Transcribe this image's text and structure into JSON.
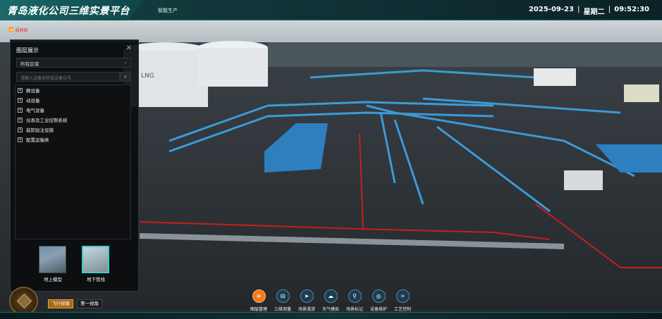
{
  "header": {
    "title": "青岛液化公司三维实景平台",
    "nav_tab": "智能生产",
    "date": "2025-09-23",
    "separator": "|",
    "weekday": "星期二",
    "time": "09:52:30"
  },
  "status": {
    "wifi_text": "弱网络"
  },
  "panel": {
    "title": "图层展示",
    "close": "✕",
    "region_select": "所有区域",
    "search_placeholder": "请输入设备名称或设备位号",
    "tree_items": [
      {
        "label": "静设备"
      },
      {
        "label": "动设备"
      },
      {
        "label": "电气设备"
      },
      {
        "label": "仪表及工业控制系统"
      },
      {
        "label": "装卸加注设施"
      },
      {
        "label": "配置运输类"
      }
    ],
    "thumbnails": [
      {
        "label": "地上模型"
      },
      {
        "label": "地下管线"
      }
    ]
  },
  "view_buttons": {
    "fly": "飞行视角",
    "first_person": "第一视角"
  },
  "toolbar": [
    {
      "label": "图层管理",
      "icon": "layers-icon",
      "glyph": "≋",
      "active": true
    },
    {
      "label": "三维测量",
      "icon": "measure-icon",
      "glyph": "⊟",
      "active": false
    },
    {
      "label": "场景漫游",
      "icon": "roam-icon",
      "glyph": "➤",
      "active": false
    },
    {
      "label": "天气模拟",
      "icon": "weather-icon",
      "glyph": "☁",
      "active": false
    },
    {
      "label": "场景标记",
      "icon": "marker-icon",
      "glyph": "⚲",
      "active": false
    },
    {
      "label": "设备维护",
      "icon": "maintenance-icon",
      "glyph": "◎",
      "active": false
    },
    {
      "label": "工艺控制",
      "icon": "process-control-icon",
      "glyph": "⌗",
      "active": false
    }
  ],
  "scene": {
    "tank_text": "LNG"
  },
  "colors": {
    "accent": "#1e6e6a",
    "active": "#f07a1a",
    "selected_thumb": "#3ad0c8"
  }
}
